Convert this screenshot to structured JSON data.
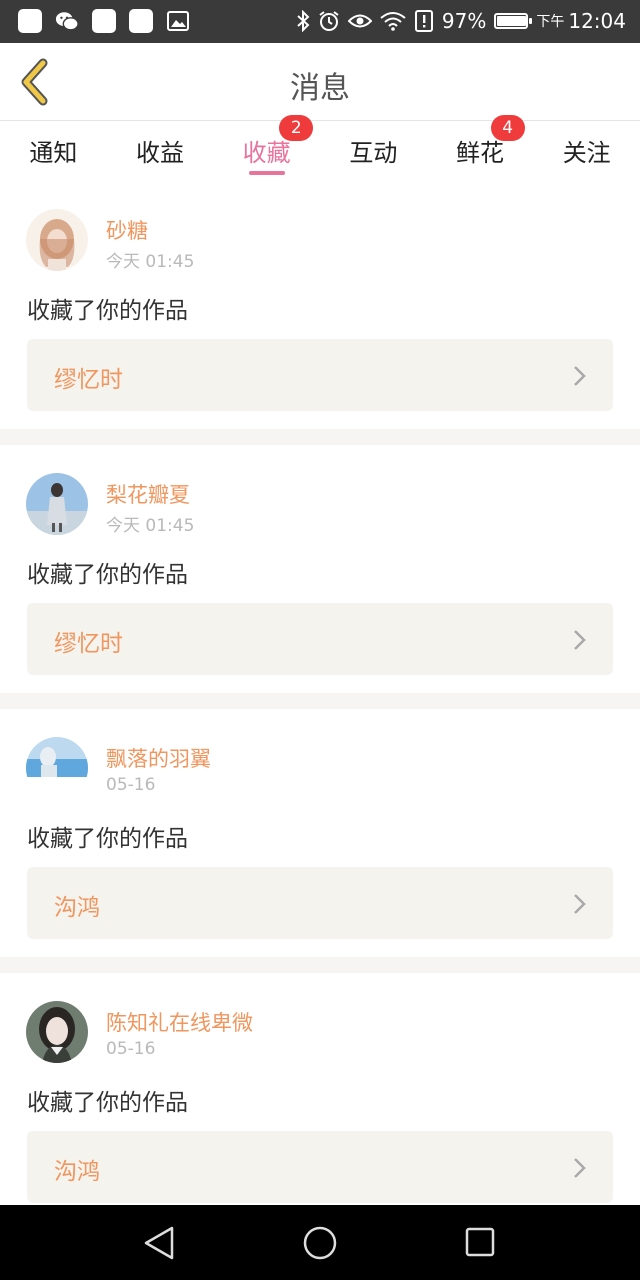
{
  "status_bar": {
    "battery_percent": "97%",
    "battery_level": 0.97,
    "time_prefix": "下午",
    "time": "12:04",
    "left_icons": [
      "notification-icon",
      "wechat-icon",
      "notification-icon",
      "notification-icon",
      "gallery-icon"
    ],
    "right_icons": [
      "bluetooth-icon",
      "alarm-icon",
      "eye-icon",
      "wifi-icon",
      "alert-icon",
      "battery-icon"
    ]
  },
  "header": {
    "title": "消息",
    "back_icon": "chevron-left-icon"
  },
  "tabs": [
    {
      "label": "通知",
      "badge": ""
    },
    {
      "label": "收益",
      "badge": ""
    },
    {
      "label": "收藏",
      "badge": "2",
      "active": true
    },
    {
      "label": "互动",
      "badge": ""
    },
    {
      "label": "鲜花",
      "badge": "4"
    },
    {
      "label": "关注",
      "badge": ""
    }
  ],
  "messages": [
    {
      "user": "砂糖",
      "time": "今天 01:45",
      "action": "收藏了你的作品",
      "work": "缪忆时"
    },
    {
      "user": "梨花瓣夏",
      "time": "今天 01:45",
      "action": "收藏了你的作品",
      "work": "缪忆时"
    },
    {
      "user": "飘落的羽翼",
      "time": "05-16",
      "action": "收藏了你的作品",
      "work": "沟鸿"
    },
    {
      "user": "陈知礼在线卑微",
      "time": "05-16",
      "action": "收藏了你的作品",
      "work": "沟鸿"
    }
  ],
  "colors": {
    "accent_pink": "#e8739b",
    "username_orange": "#f0965e",
    "badge_red": "#ef3b3b",
    "back_icon_yellow": "#f0c848",
    "card_bg": "#f5f3ee"
  },
  "nav_bar": {
    "icons": [
      "back-triangle-icon",
      "home-circle-icon",
      "recents-square-icon"
    ]
  }
}
